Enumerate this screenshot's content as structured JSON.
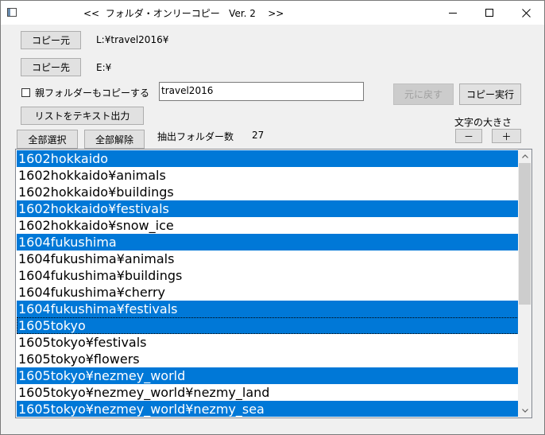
{
  "window": {
    "title": "<<  フォルダ・オンリーコピー   Ver. 2    >>"
  },
  "controls": {
    "copy_source_button": "コピー元",
    "copy_source_path": "L:¥travel2016¥",
    "copy_dest_button": "コピー先",
    "copy_dest_path": "E:¥",
    "parent_folder_checkbox_label": "親フォルダーもコピーする",
    "parent_folder_name": "travel2016",
    "undo_button": "元に戻す",
    "execute_copy_button": "コピー実行",
    "export_list_button": "リストをテキスト出力",
    "font_size_label": "文字の大きさ",
    "font_smaller_button": "－",
    "font_larger_button": "＋",
    "select_all_button": "全部選択",
    "deselect_all_button": "全部解除",
    "folder_count_label": "抽出フォルダー数",
    "folder_count_value": "27"
  },
  "folder_list": [
    {
      "name": "1602hokkaido",
      "selected": true
    },
    {
      "name": "1602hokkaido¥animals",
      "selected": false
    },
    {
      "name": "1602hokkaido¥buildings",
      "selected": false
    },
    {
      "name": "1602hokkaido¥festivals",
      "selected": true
    },
    {
      "name": "1602hokkaido¥snow_ice",
      "selected": false
    },
    {
      "name": "1604fukushima",
      "selected": true
    },
    {
      "name": "1604fukushima¥animals",
      "selected": false
    },
    {
      "name": "1604fukushima¥buildings",
      "selected": false
    },
    {
      "name": "1604fukushima¥cherry",
      "selected": false
    },
    {
      "name": "1604fukushima¥festivals",
      "selected": true
    },
    {
      "name": "1605tokyo",
      "selected": true,
      "focused": true
    },
    {
      "name": "1605tokyo¥festivals",
      "selected": false
    },
    {
      "name": "1605tokyo¥flowers",
      "selected": false
    },
    {
      "name": "1605tokyo¥nezmey_world",
      "selected": true
    },
    {
      "name": "1605tokyo¥nezmey_world¥nezmy_land",
      "selected": false
    },
    {
      "name": "1605tokyo¥nezmey_world¥nezmy_sea",
      "selected": true
    }
  ],
  "colors": {
    "selection": "#0078d7",
    "window_bg": "#f0f0f0"
  }
}
